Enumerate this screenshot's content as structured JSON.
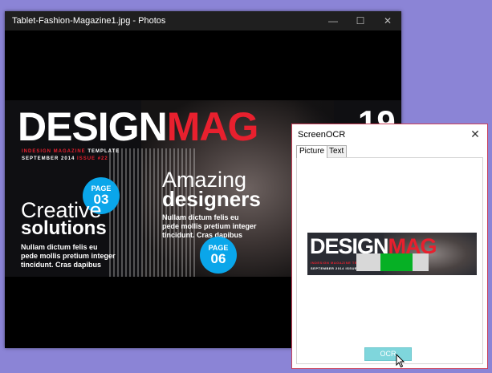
{
  "photos_window": {
    "title": "Tablet-Fashion-Magazine1.jpg - Photos",
    "controls": {
      "minimize": "—",
      "maximize": "☐",
      "close": "✕"
    }
  },
  "magazine": {
    "logo_white": "DESIGN",
    "logo_red": "MAG",
    "tagline_red": "INDESIGN MAGAZINE",
    "tagline_white": " TEMPLATE",
    "date_white": "SEPTEMBER 2014 ",
    "date_red": "ISSUE #22",
    "badge1_top": "PAGE",
    "badge1_num": "03",
    "badge2_top": "PAGE",
    "badge2_num": "06",
    "headline1_line1": "Creative",
    "headline1_line2": "solutions",
    "body1": [
      "Nullam dictum felis eu",
      "pede mollis pretium integer",
      "tincidunt. Cras dapibus"
    ],
    "headline2_line1": "Amazing",
    "headline2_line2": "designers",
    "body2": [
      "Nullam dictum felis eu",
      "pede mollis pretium integer",
      "tincidunt. Cras dapibus"
    ],
    "corner_number": "19"
  },
  "ocr_window": {
    "title": "ScreenOCR",
    "close": "✕",
    "tabs": [
      {
        "label": "Picture",
        "active": true
      },
      {
        "label": "Text",
        "active": false
      }
    ],
    "thumbnail": {
      "logo_white": "DESIGN",
      "logo_red": "MAG",
      "tag": "INDESIGN MAGAZINE TEMPLATE",
      "date": "SEPTEMBER 2014 ISSUE #22"
    },
    "progress": {
      "start": 0.33,
      "end": 0.78
    },
    "ocr_button": "OCR"
  },
  "colors": {
    "accent_red": "#e8202e",
    "badge_blue": "#0aa6ea",
    "progress_green": "#06b025",
    "button_teal": "#7fd6dc"
  }
}
